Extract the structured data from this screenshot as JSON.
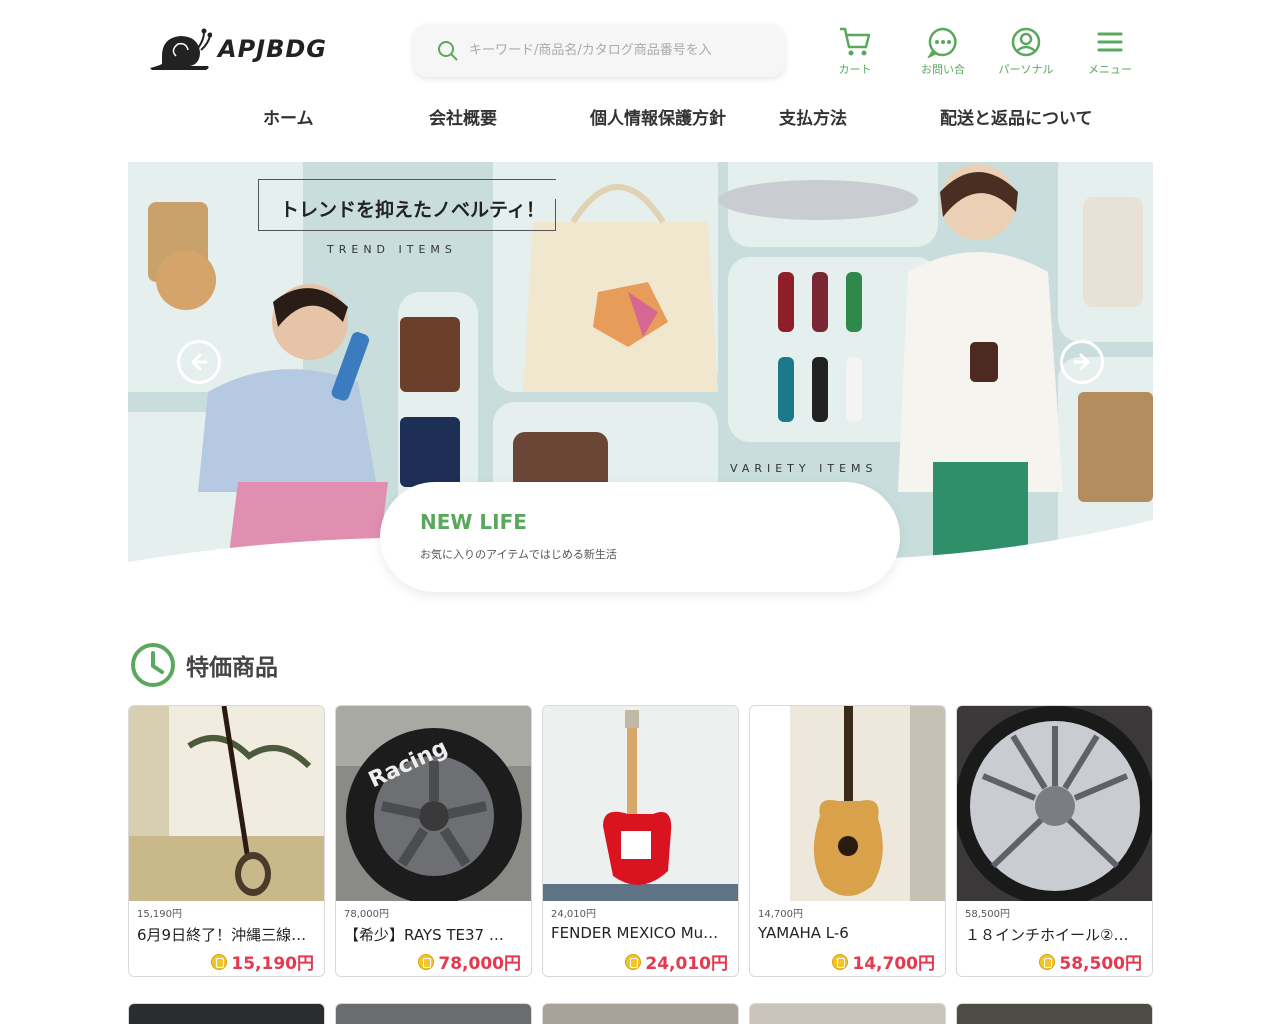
{
  "header": {
    "logo_text": "APJBDG",
    "search_placeholder": "キーワード/商品名/カタログ商品番号を入",
    "icons": [
      {
        "label": "カート",
        "icon": "cart-icon"
      },
      {
        "label": "お問い合",
        "icon": "chat-icon"
      },
      {
        "label": "パーソナル",
        "icon": "user-icon"
      },
      {
        "label": "メニュー",
        "icon": "menu-icon"
      }
    ]
  },
  "nav": [
    "ホーム",
    "会社概要",
    "個人情報保護方針",
    "支払方法",
    "配送と返品について"
  ],
  "banner": {
    "headline": "トレンドを抑えたノベルティ！",
    "trend_sub": "TREND ITEMS",
    "variety_sub": "VARIETY ITEMS",
    "card_title": "NEW LIFE",
    "card_text": "お気に入りのアイテムではじめる新生活"
  },
  "section": {
    "title": "特価商品"
  },
  "products": [
    {
      "small_price": "15,190円",
      "name": "6月9日終了！沖縄三線…",
      "price": "15,190円"
    },
    {
      "small_price": "78,000円",
      "name": "【希少】RAYS TE37 …",
      "price": "78,000円"
    },
    {
      "small_price": "24,010円",
      "name": "FENDER MEXICO Mu…",
      "price": "24,010円"
    },
    {
      "small_price": "14,700円",
      "name": "YAMAHA L-6",
      "price": "14,700円"
    },
    {
      "small_price": "58,500円",
      "name": "１８インチホイール②…",
      "price": "58,500円"
    }
  ],
  "colors": {
    "accent_green": "#5aa85e",
    "price_red": "#e6384e",
    "banner_bg": "#c9dedc"
  }
}
